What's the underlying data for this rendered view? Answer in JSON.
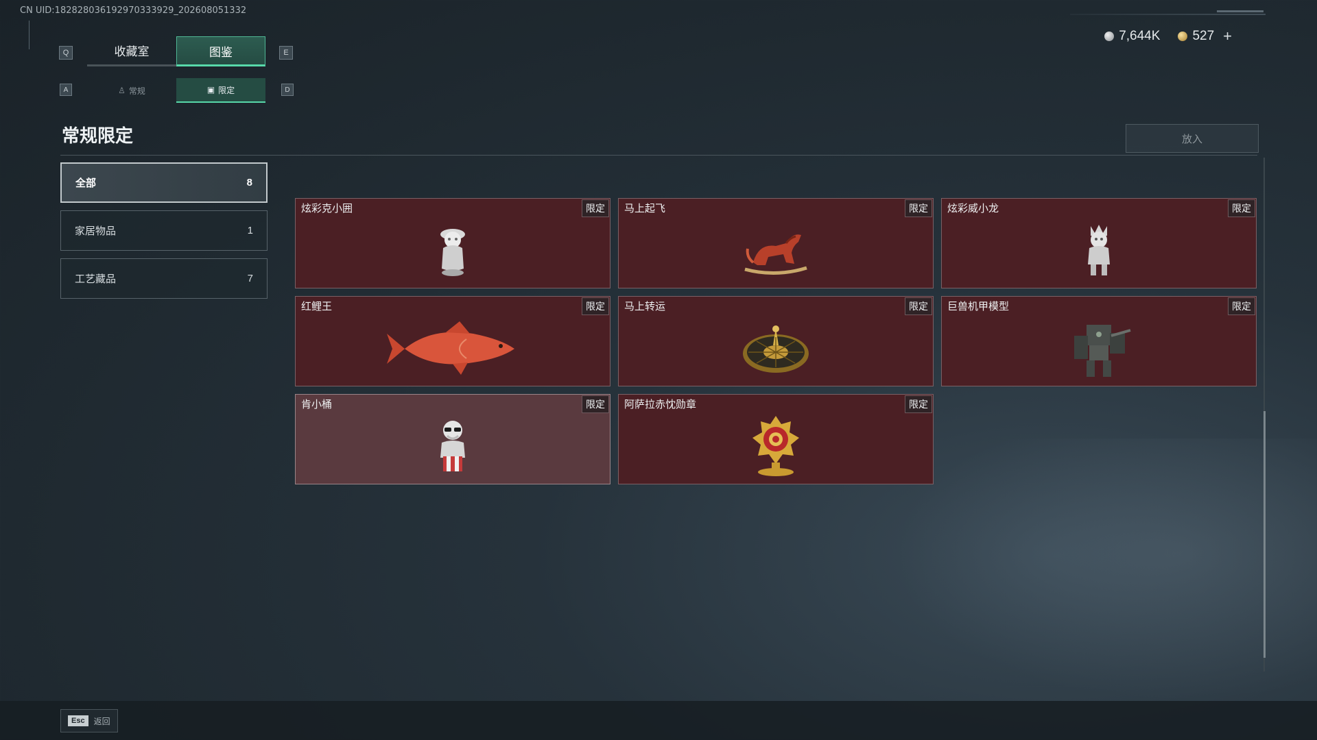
{
  "uid": "CN UID:182828036192970333929_202608051332",
  "currency": {
    "silver": "7,644K",
    "gold": "527",
    "plus": "+"
  },
  "keys": {
    "q": "Q",
    "e": "E",
    "a": "A",
    "d": "D",
    "esc": "Esc"
  },
  "tabs_main": [
    {
      "label": "收藏室",
      "active": false
    },
    {
      "label": "图鉴",
      "active": true
    }
  ],
  "tabs_sub": [
    {
      "label": "常规",
      "icon": "figure-icon",
      "active": false
    },
    {
      "label": "限定",
      "icon": "picture-icon",
      "active": true
    }
  ],
  "page_title": "常规限定",
  "put_button": "放入",
  "categories": [
    {
      "label": "全部",
      "count": "8",
      "active": true
    },
    {
      "label": "家居物品",
      "count": "1",
      "active": false
    },
    {
      "label": "工艺藏品",
      "count": "7",
      "active": false
    }
  ],
  "items": [
    {
      "name": "炫彩克小囲",
      "badge": "限定",
      "art": "figurine-girl"
    },
    {
      "name": "马上起飞",
      "badge": "限定",
      "art": "horse"
    },
    {
      "name": "炫彩威小龙",
      "badge": "限定",
      "art": "figurine-dragon"
    },
    {
      "name": "红鲤王",
      "badge": "限定",
      "art": "carp"
    },
    {
      "name": "马上转运",
      "badge": "限定",
      "art": "wheel"
    },
    {
      "name": "巨兽机甲模型",
      "badge": "限定",
      "art": "mech"
    },
    {
      "name": "肯小桶",
      "badge": "限定",
      "art": "colonel"
    },
    {
      "name": "阿萨拉赤忱勋章",
      "badge": "限定",
      "art": "medal"
    }
  ],
  "footer": {
    "back": "返回"
  },
  "colors": {
    "accent": "#58d9aa",
    "card": "#4b1f24",
    "card_hover": "#5a3a3f"
  }
}
